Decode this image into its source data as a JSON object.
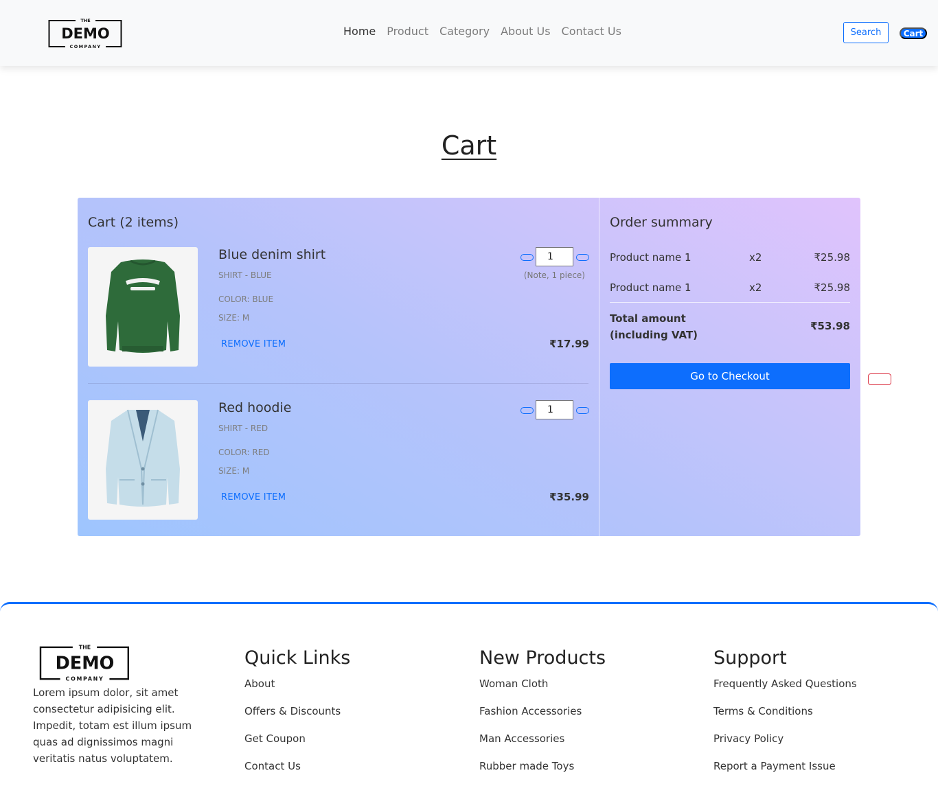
{
  "nav": {
    "logo": {
      "top": "THE",
      "main": "DEMO",
      "bottom": "COMPANY"
    },
    "links": [
      "Home",
      "Product",
      "Category",
      "About Us",
      "Contact Us"
    ],
    "search_label": "Search",
    "cart_label": "Cart"
  },
  "page": {
    "title": "Cart"
  },
  "cart": {
    "title": "Cart (2 items)",
    "remove_label": "REMOVE ITEM",
    "items": [
      {
        "name": "Blue denim shirt",
        "type": "SHIRT - BLUE",
        "color": "COLOR: BLUE",
        "size": "SIZE: M",
        "qty": "1",
        "note": "(Note, 1 piece)",
        "price": "₹17.99",
        "image": "green-sweatshirt-image"
      },
      {
        "name": "Red hoodie",
        "type": "SHIRT - RED",
        "color": "COLOR: RED",
        "size": "SIZE: M",
        "qty": "1",
        "price": "₹35.99",
        "image": "denim-jacket-image"
      }
    ]
  },
  "summary": {
    "title": "Order summary",
    "rows": [
      {
        "name": "Product name 1",
        "qty": "x2",
        "price": "₹25.98"
      },
      {
        "name": "Product name 1",
        "qty": "x2",
        "price": "₹25.98"
      }
    ],
    "total_label_1": "Total amount",
    "total_label_2": "(including VAT)",
    "total_value": "₹53.98",
    "checkout_label": "Go to Checkout"
  },
  "footer": {
    "logo": {
      "top": "THE",
      "main": "DEMO",
      "bottom": "COMPANY"
    },
    "description": "Lorem ipsum dolor, sit amet consectetur adipisicing elit. Impedit, totam est illum ipsum quas ad dignissimos magni veritatis natus voluptatem.",
    "columns": [
      {
        "title": "Quick Links",
        "links": [
          "About",
          "Offers & Discounts",
          "Get Coupon",
          "Contact Us"
        ]
      },
      {
        "title": "New Products",
        "links": [
          "Woman Cloth",
          "Fashion Accessories",
          "Man Accessories",
          "Rubber made Toys"
        ]
      },
      {
        "title": "Support",
        "links": [
          "Frequently Asked Questions",
          "Terms & Conditions",
          "Privacy Policy",
          "Report a Payment Issue"
        ]
      }
    ]
  },
  "colors": {
    "primary": "#0d6efd",
    "danger": "#dc3545",
    "gradient_start": "#9ec5fe",
    "gradient_end": "#e0c3fc"
  }
}
